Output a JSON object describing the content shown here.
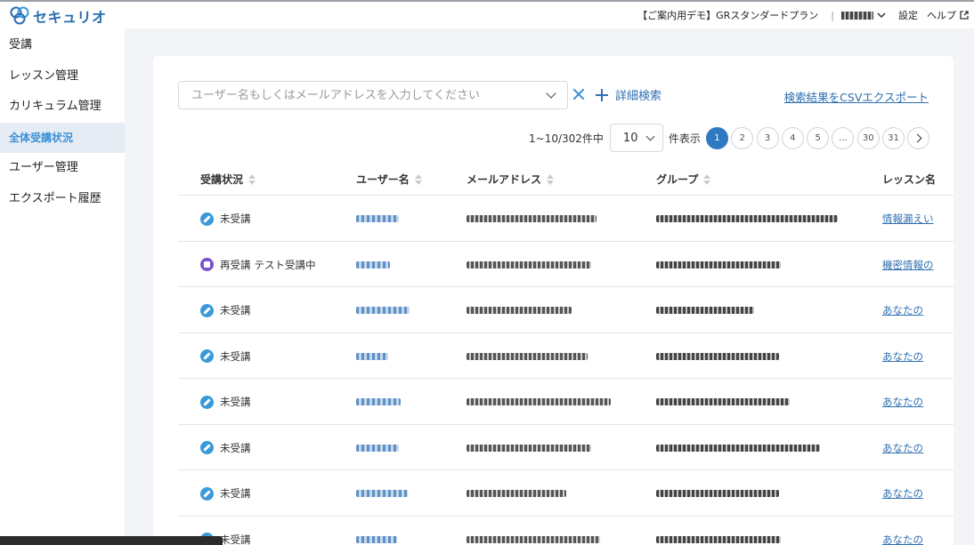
{
  "app": {
    "logo_text": "セキュリオ",
    "brand_color": "#2a6db0"
  },
  "header": {
    "plan": "【ご案内用デモ】GRスタンダードプラン",
    "separator": "|",
    "settings": "設定",
    "help": "ヘルプ"
  },
  "sidebar": {
    "items": [
      {
        "label": "受講"
      },
      {
        "label": "レッスン管理"
      },
      {
        "label": "カリキュラム管理"
      },
      {
        "label": "全体受講状況"
      },
      {
        "label": "ユーザー管理"
      },
      {
        "label": "エクスポート履歴"
      }
    ]
  },
  "search": {
    "placeholder": "ユーザー名もしくはメールアドレスを入力してください",
    "advanced": "詳細検索",
    "csv_export": "検索結果をCSVエクスポート"
  },
  "pagination": {
    "range": "1~10/302件中",
    "per_page": "10",
    "unit": "件表示",
    "pages": [
      "1",
      "2",
      "3",
      "4",
      "5",
      "...",
      "30",
      "31"
    ],
    "current": "1"
  },
  "table": {
    "columns": [
      "受講状況",
      "ユーザー名",
      "メールアドレス",
      "グループ",
      "レッスン名"
    ],
    "rows": [
      {
        "status": "未受講",
        "status_sub": "",
        "icon": "pencil-icon",
        "lesson": "情報漏えい"
      },
      {
        "status": "再受講",
        "status_sub": "テスト受講中",
        "icon": "clipboard-icon",
        "lesson": "機密情報の"
      },
      {
        "status": "未受講",
        "status_sub": "",
        "icon": "pencil-icon",
        "lesson": "あなたの"
      },
      {
        "status": "未受講",
        "status_sub": "",
        "icon": "pencil-icon",
        "lesson": "あなたの"
      },
      {
        "status": "未受講",
        "status_sub": "",
        "icon": "pencil-icon",
        "lesson": "あなたの"
      },
      {
        "status": "未受講",
        "status_sub": "",
        "icon": "pencil-icon",
        "lesson": "あなたの"
      },
      {
        "status": "未受講",
        "status_sub": "",
        "icon": "pencil-icon",
        "lesson": "あなたの"
      },
      {
        "status": "未受講",
        "status_sub": "",
        "icon": "pencil-icon",
        "lesson": "あなたの"
      }
    ]
  },
  "colors": {
    "accent": "#3a8fd4",
    "link": "#2f6fb0",
    "pending_icon": "#3a9ad9",
    "retake_icon": "#7b52c9"
  }
}
